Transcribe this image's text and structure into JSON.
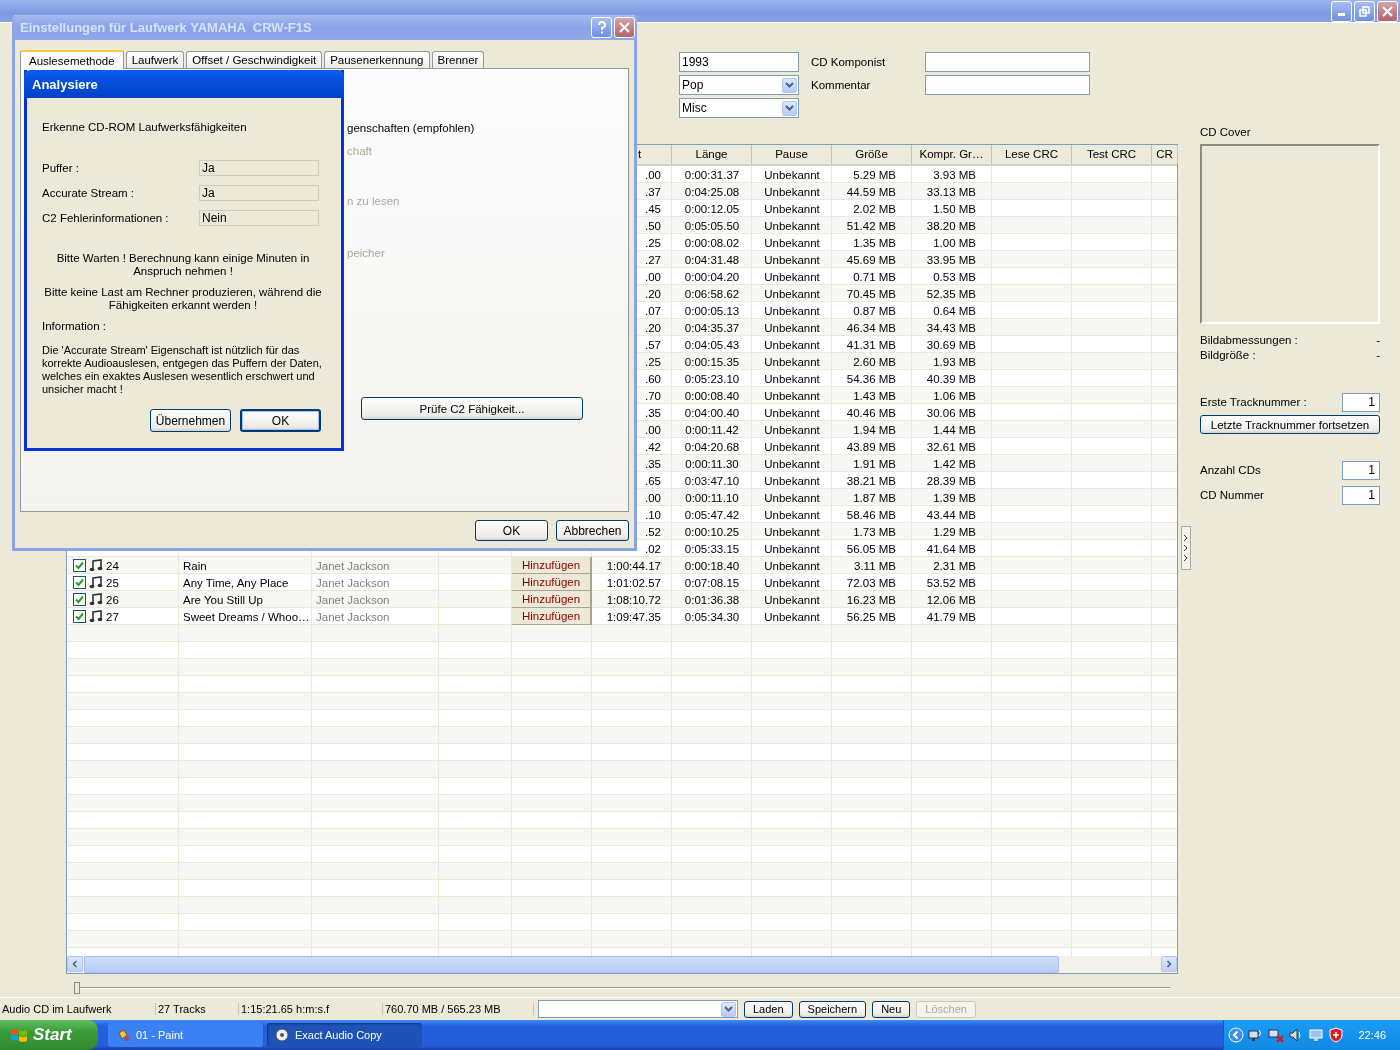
{
  "album_fields": [
    {
      "kind": "input",
      "value": "1993"
    },
    {
      "kind": "select",
      "value": "Pop"
    },
    {
      "kind": "select",
      "value": "Misc"
    }
  ],
  "cd_fields": [
    {
      "label": "CD Komponist"
    },
    {
      "label": "Kommentar"
    }
  ],
  "table": {
    "columns": [
      "t",
      "Länge",
      "Pause",
      "Größe",
      "Kompr. Gr…",
      "Lese CRC",
      "Test CRC",
      "CR"
    ],
    "rows": [
      {
        "start": ".00",
        "length": "0:00:31.37",
        "pause": "Unbekannt",
        "size": "5.29 MB",
        "compressed": "3.93 MB"
      },
      {
        "start": ".37",
        "length": "0:04:25.08",
        "pause": "Unbekannt",
        "size": "44.59 MB",
        "compressed": "33.13 MB"
      },
      {
        "start": ".45",
        "length": "0:00:12.05",
        "pause": "Unbekannt",
        "size": "2.02 MB",
        "compressed": "1.50 MB"
      },
      {
        "start": ".50",
        "length": "0:05:05.50",
        "pause": "Unbekannt",
        "size": "51.42 MB",
        "compressed": "38.20 MB"
      },
      {
        "start": ".25",
        "length": "0:00:08.02",
        "pause": "Unbekannt",
        "size": "1.35 MB",
        "compressed": "1.00 MB"
      },
      {
        "start": ".27",
        "length": "0:04:31.48",
        "pause": "Unbekannt",
        "size": "45.69 MB",
        "compressed": "33.95 MB"
      },
      {
        "start": ".00",
        "length": "0:00:04.20",
        "pause": "Unbekannt",
        "size": "0.71 MB",
        "compressed": "0.53 MB"
      },
      {
        "start": ".20",
        "length": "0:06:58.62",
        "pause": "Unbekannt",
        "size": "70.45 MB",
        "compressed": "52.35 MB"
      },
      {
        "start": ".07",
        "length": "0:00:05.13",
        "pause": "Unbekannt",
        "size": "0.87 MB",
        "compressed": "0.64 MB"
      },
      {
        "start": ".20",
        "length": "0:04:35.37",
        "pause": "Unbekannt",
        "size": "46.34 MB",
        "compressed": "34.43 MB"
      },
      {
        "start": ".57",
        "length": "0:04:05.43",
        "pause": "Unbekannt",
        "size": "41.31 MB",
        "compressed": "30.69 MB"
      },
      {
        "start": ".25",
        "length": "0:00:15.35",
        "pause": "Unbekannt",
        "size": "2.60 MB",
        "compressed": "1.93 MB"
      },
      {
        "start": ".60",
        "length": "0:05:23.10",
        "pause": "Unbekannt",
        "size": "54.36 MB",
        "compressed": "40.39 MB"
      },
      {
        "start": ".70",
        "length": "0:00:08.40",
        "pause": "Unbekannt",
        "size": "1.43 MB",
        "compressed": "1.06 MB"
      },
      {
        "start": ".35",
        "length": "0:04:00.40",
        "pause": "Unbekannt",
        "size": "40.46 MB",
        "compressed": "30.06 MB"
      },
      {
        "start": ".00",
        "length": "0:00:11.42",
        "pause": "Unbekannt",
        "size": "1.94 MB",
        "compressed": "1.44 MB"
      },
      {
        "start": ".42",
        "length": "0:04:20.68",
        "pause": "Unbekannt",
        "size": "43.89 MB",
        "compressed": "32.61 MB"
      },
      {
        "start": ".35",
        "length": "0:00:11.30",
        "pause": "Unbekannt",
        "size": "1.91 MB",
        "compressed": "1.42 MB"
      },
      {
        "start": ".65",
        "length": "0:03:47.10",
        "pause": "Unbekannt",
        "size": "38.21 MB",
        "compressed": "28.39 MB"
      },
      {
        "start": ".00",
        "length": "0:00:11.10",
        "pause": "Unbekannt",
        "size": "1.87 MB",
        "compressed": "1.39 MB"
      },
      {
        "start": ".10",
        "length": "0:05:47.42",
        "pause": "Unbekannt",
        "size": "58.46 MB",
        "compressed": "43.44 MB"
      },
      {
        "start": ".52",
        "length": "0:00:10.25",
        "pause": "Unbekannt",
        "size": "1.73 MB",
        "compressed": "1.29 MB"
      },
      {
        "start": ".02",
        "length": "0:05:33.15",
        "pause": "Unbekannt",
        "size": "56.05 MB",
        "compressed": "41.64 MB"
      },
      {
        "checked": true,
        "track": "24",
        "title": "Rain",
        "artist": "Janet Jackson",
        "action": "Hinzufügen",
        "start": "1:00:44.17",
        "length": "0:00:18.40",
        "pause": "Unbekannt",
        "size": "3.11 MB",
        "compressed": "2.31 MB"
      },
      {
        "checked": true,
        "track": "25",
        "title": "Any Time, Any Place",
        "artist": "Janet Jackson",
        "action": "Hinzufügen",
        "start": "1:01:02.57",
        "length": "0:07:08.15",
        "pause": "Unbekannt",
        "size": "72.03 MB",
        "compressed": "53.52 MB"
      },
      {
        "checked": true,
        "track": "26",
        "title": "Are You Still Up",
        "artist": "Janet Jackson",
        "action": "Hinzufügen",
        "start": "1:08:10.72",
        "length": "0:01:36.38",
        "pause": "Unbekannt",
        "size": "16.23 MB",
        "compressed": "12.06 MB"
      },
      {
        "checked": true,
        "track": "27",
        "title": "Sweet Dreams / Whoo…",
        "artist": "Janet Jackson",
        "action": "Hinzufügen",
        "start": "1:09:47.35",
        "length": "0:05:34.30",
        "pause": "Unbekannt",
        "size": "56.25 MB",
        "compressed": "41.79 MB"
      }
    ]
  },
  "seek_slider": {
    "level": 0
  },
  "right_panel": {
    "cover_label": "CD Cover",
    "image_info": [
      {
        "label": "Bildabmessungen :",
        "value": "-"
      },
      {
        "label": "Bildgröße :",
        "value": "-"
      }
    ],
    "first_track": {
      "label": "Erste Tracknummer :",
      "value": "1"
    },
    "continue_button": "Letzte Tracknummer fortsetzen",
    "counters": [
      {
        "label": "Anzahl CDs",
        "value": "1"
      },
      {
        "label": "CD Nummer",
        "value": "1"
      }
    ]
  },
  "status_bar": {
    "cells": [
      "Audio CD im Laufwerk",
      "27 Tracks",
      "1:15:21.65 h:m:s.f",
      "760.70 MB / 565.23 MB"
    ],
    "buttons": [
      {
        "label": "Laden",
        "disabled": false
      },
      {
        "label": "Speichern",
        "disabled": false
      },
      {
        "label": "Neu",
        "disabled": false
      },
      {
        "label": "Löschen",
        "disabled": true
      }
    ]
  },
  "taskbar": {
    "start": "Start",
    "tasks": [
      {
        "label": "01 - Paint",
        "selected": false
      },
      {
        "label": "Exact Audio Copy",
        "selected": true
      }
    ],
    "clock": "22:46"
  },
  "settings_dialog": {
    "title": "Einstellungen für Laufwerk YAMAHA  CRW-F1S",
    "tabs": [
      {
        "label": "Auslesemethode",
        "selected": true
      },
      {
        "label": "Laufwerk",
        "selected": false
      },
      {
        "label": "Offset / Geschwindigkeit",
        "selected": false
      },
      {
        "label": "Pausenerkennung",
        "selected": false
      },
      {
        "label": "Brenner",
        "selected": false
      }
    ],
    "fragments": [
      {
        "text": "genschaften (empfohlen)",
        "disabled": false
      },
      {
        "text": "chaft",
        "disabled": true
      },
      {
        "text": "n zu lesen",
        "disabled": true
      },
      {
        "text": "peicher",
        "disabled": true
      }
    ],
    "c2_button": "Prüfe C2 Fähigkeit...",
    "buttons": [
      "OK",
      "Abbrechen"
    ]
  },
  "analyze_dialog": {
    "title": "Analysiere",
    "heading": "Erkenne CD-ROM Laufwerksfähigkeiten",
    "results": [
      {
        "label": "Puffer :",
        "value": "Ja"
      },
      {
        "label": "Accurate Stream :",
        "value": "Ja"
      },
      {
        "label": "C2 Fehlerinformationen :",
        "value": "Nein"
      }
    ],
    "notes": [
      "Bitte Warten !  Berechnung kann einige Minuten in Anspruch nehmen !",
      "Bitte keine Last am Rechner produzieren, während die Fähigkeiten erkannt werden !"
    ],
    "info_label": "Information :",
    "info_text": "Die 'Accurate Stream' Eigenschaft ist nützlich für das korrekte Audioauslesen, entgegen das Puffern der Daten, welches ein exaktes Auslesen wesentlich erschwert und unsicher macht !",
    "buttons": [
      {
        "label": "Übernehmen",
        "default": false
      },
      {
        "label": "OK",
        "default": true
      }
    ]
  }
}
